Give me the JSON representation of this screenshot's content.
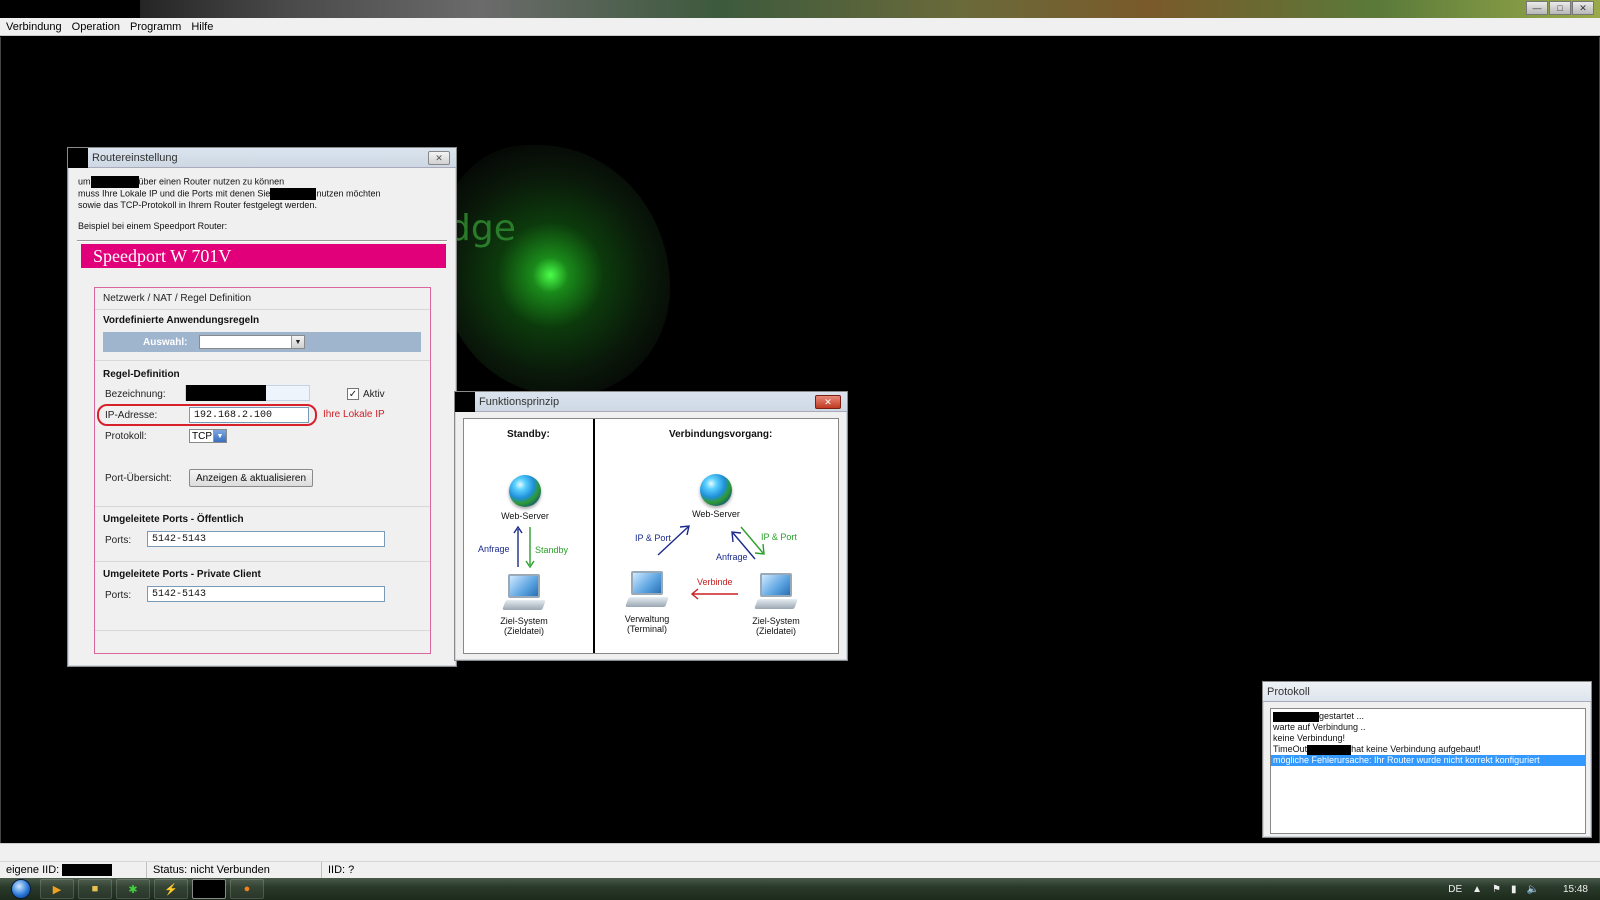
{
  "menubar": {
    "items": [
      "Verbindung",
      "Operation",
      "Programm",
      "Hilfe"
    ]
  },
  "router_dialog": {
    "title": "Routereinstellung",
    "intro": {
      "line1_pre": "um",
      "line1_post": "über einen Router nutzen zu können",
      "line2_pre": "muss Ihre Lokale IP und die Ports mit denen Sie",
      "line2_post": "nutzen möchten",
      "line3": "sowie das TCP-Protokoll in Ihrem Router festgelegt werden.",
      "line4": "Beispiel bei einem Speedport Router:"
    },
    "banner": "Speedport W 701V",
    "panel": {
      "header": "Netzwerk / NAT / Regel Definition",
      "predefined_title": "Vordefinierte Anwendungsregeln",
      "auswahl_label": "Auswahl:",
      "rule_title": "Regel-Definition",
      "bezeichnung_label": "Bezeichnung:",
      "aktiv_label": "Aktiv",
      "ip_label": "IP-Adresse:",
      "ip_value": "192.168.2.100",
      "ip_hint": "Ihre Lokale IP",
      "protokoll_label": "Protokoll:",
      "protokoll_value": "TCP",
      "port_uebersicht_label": "Port-Übersicht:",
      "anzeigen_button": "Anzeigen & aktualisieren",
      "public_title": "Umgeleitete Ports - Öffentlich",
      "public_ports_label": "Ports:",
      "public_ports_value": "5142-5143",
      "private_title": "Umgeleitete Ports - Private Client",
      "private_ports_label": "Ports:",
      "private_ports_value": "5142-5143"
    }
  },
  "funk_dialog": {
    "title": "Funktionsprinzip",
    "standby": {
      "heading": "Standby:",
      "web_server": "Web-Server",
      "anfrage": "Anfrage",
      "standby": "Standby",
      "ziel_line1": "Ziel-System",
      "ziel_line2": "(Zieldatei)"
    },
    "verbindung": {
      "heading": "Verbindungsvorgang:",
      "web_server": "Web-Server",
      "ip_port_left": "IP & Port",
      "ip_port_right": "IP & Port",
      "anfrage": "Anfrage",
      "verbinde": "Verbinde",
      "verwaltung_line1": "Verwaltung",
      "verwaltung_line2": "(Terminal)",
      "ziel_line1": "Ziel-System",
      "ziel_line2": "(Zieldatei)"
    }
  },
  "protokoll": {
    "title": "Protokoll",
    "lines": [
      {
        "pre": "",
        "post": "gestartet ..."
      },
      {
        "pre": "warte auf Verbindung ..",
        "post": ""
      },
      {
        "pre": "keine Verbindung!",
        "post": ""
      },
      {
        "pre": "TimeOut",
        "post": "hat keine Verbindung aufgebaut!"
      },
      {
        "pre": "mögliche Fehlerursache: Ihr Router wurde nicht korrekt konfiguriert",
        "post": ""
      }
    ]
  },
  "statusbar": {
    "eigene_iid_label": "eigene IID:",
    "status": "Status: nicht Verbunden",
    "iid": "IID: ?"
  },
  "background": {
    "art_text": "dge"
  },
  "taskbar": {
    "language": "DE",
    "time": "15:48"
  },
  "colors": {
    "telekom_magenta": "#e2007a",
    "highlight_red": "#d8202a",
    "selection_blue": "#3399ff"
  }
}
